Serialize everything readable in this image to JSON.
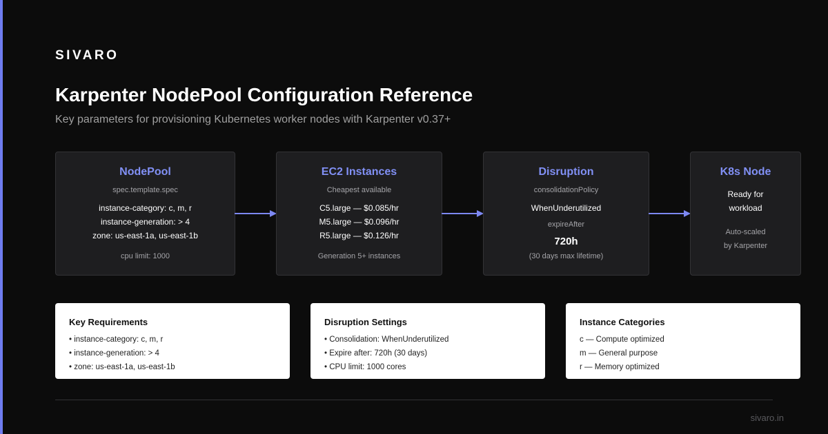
{
  "brand": "SIVARO",
  "title": "Karpenter NodePool Configuration Reference",
  "subtitle": "Key parameters for provisioning Kubernetes worker nodes with Karpenter v0.37+",
  "colors": {
    "accent": "#6f7cf0",
    "box_title": "#8190f5",
    "background": "#0c0c0c",
    "box_bg": "#1e1e20"
  },
  "flow": [
    {
      "title": "NodePool",
      "subtitle": "spec.template.spec",
      "lines": [
        "instance-category: c, m, r",
        "instance-generation: > 4",
        "zone: us-east-1a, us-east-1b"
      ],
      "footer": "cpu limit: 1000"
    },
    {
      "title": "EC2 Instances",
      "subtitle": "Cheapest available",
      "lines": [
        "C5.large — $0.085/hr",
        "M5.large — $0.096/hr",
        "R5.large — $0.126/hr"
      ],
      "footer": "Generation 5+ instances"
    },
    {
      "title": "Disruption",
      "label1": "consolidationPolicy",
      "value1": "WhenUnderutilized",
      "label2": "expireAfter",
      "value2": "720h",
      "note": "(30 days max lifetime)"
    },
    {
      "title": "K8s Node",
      "lines": [
        "Ready for",
        "workload"
      ],
      "notes": [
        "Auto-scaled",
        "by Karpenter"
      ]
    }
  ],
  "cards": [
    {
      "title": "Key Requirements",
      "lines": [
        "• instance-category: c, m, r",
        "• instance-generation: > 4",
        "• zone: us-east-1a, us-east-1b"
      ]
    },
    {
      "title": "Disruption Settings",
      "lines": [
        "• Consolidation: WhenUnderutilized",
        "• Expire after: 720h (30 days)",
        "• CPU limit: 1000 cores"
      ]
    },
    {
      "title": "Instance Categories",
      "lines": [
        "c — Compute optimized",
        "m — General purpose",
        "r — Memory optimized"
      ]
    }
  ],
  "footer": "sivaro.in"
}
